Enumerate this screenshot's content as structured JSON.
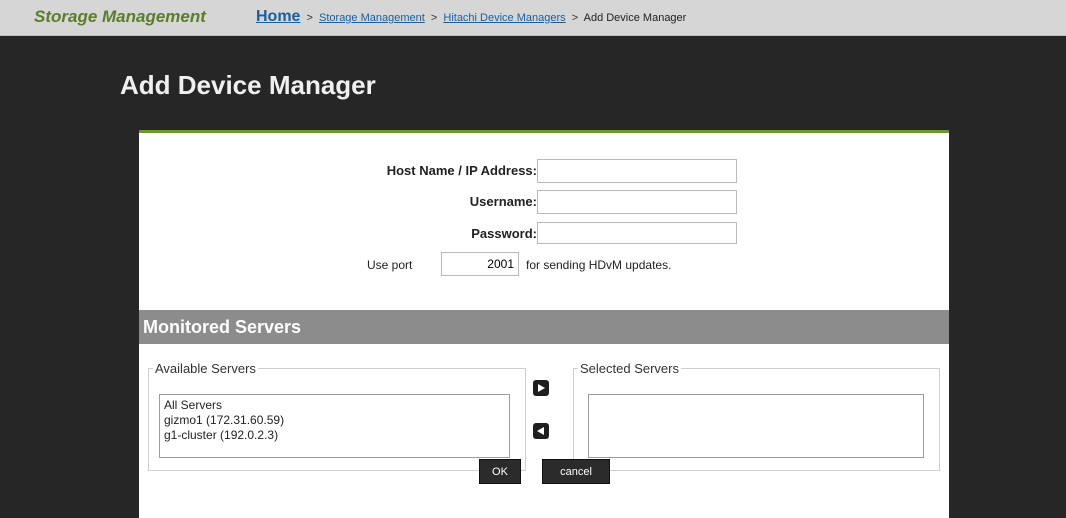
{
  "header": {
    "app_title": "Storage Management",
    "breadcrumb": {
      "home": "Home",
      "separator": ">",
      "storage_management": "Storage Management",
      "hitachi_device_managers": "Hitachi Device Managers",
      "current": "Add Device Manager"
    }
  },
  "page": {
    "title": "Add Device Manager"
  },
  "form": {
    "host_label": "Host Name / IP Address:",
    "host_value": "",
    "username_label": "Username:",
    "username_value": "",
    "password_label": "Password:",
    "password_value": "",
    "port_prefix": "Use port",
    "port_value": "2001",
    "port_suffix": "for sending HDvM updates."
  },
  "monitored": {
    "section_title": "Monitored Servers",
    "available_legend": "Available Servers",
    "available_items": [
      "All Servers",
      "gizmo1 (172.31.60.59)",
      "g1-cluster (192.0.2.3)"
    ],
    "selected_legend": "Selected Servers",
    "add_icon": "arrow-right-icon",
    "remove_icon": "arrow-left-icon"
  },
  "buttons": {
    "ok": "OK",
    "cancel": "cancel"
  },
  "colors": {
    "app_title": "#5a7d2c",
    "page_background": "#262626",
    "section_bar": "#8c8c8c",
    "panel_accent": "#6a9a2e",
    "link": "#1f5d99"
  }
}
